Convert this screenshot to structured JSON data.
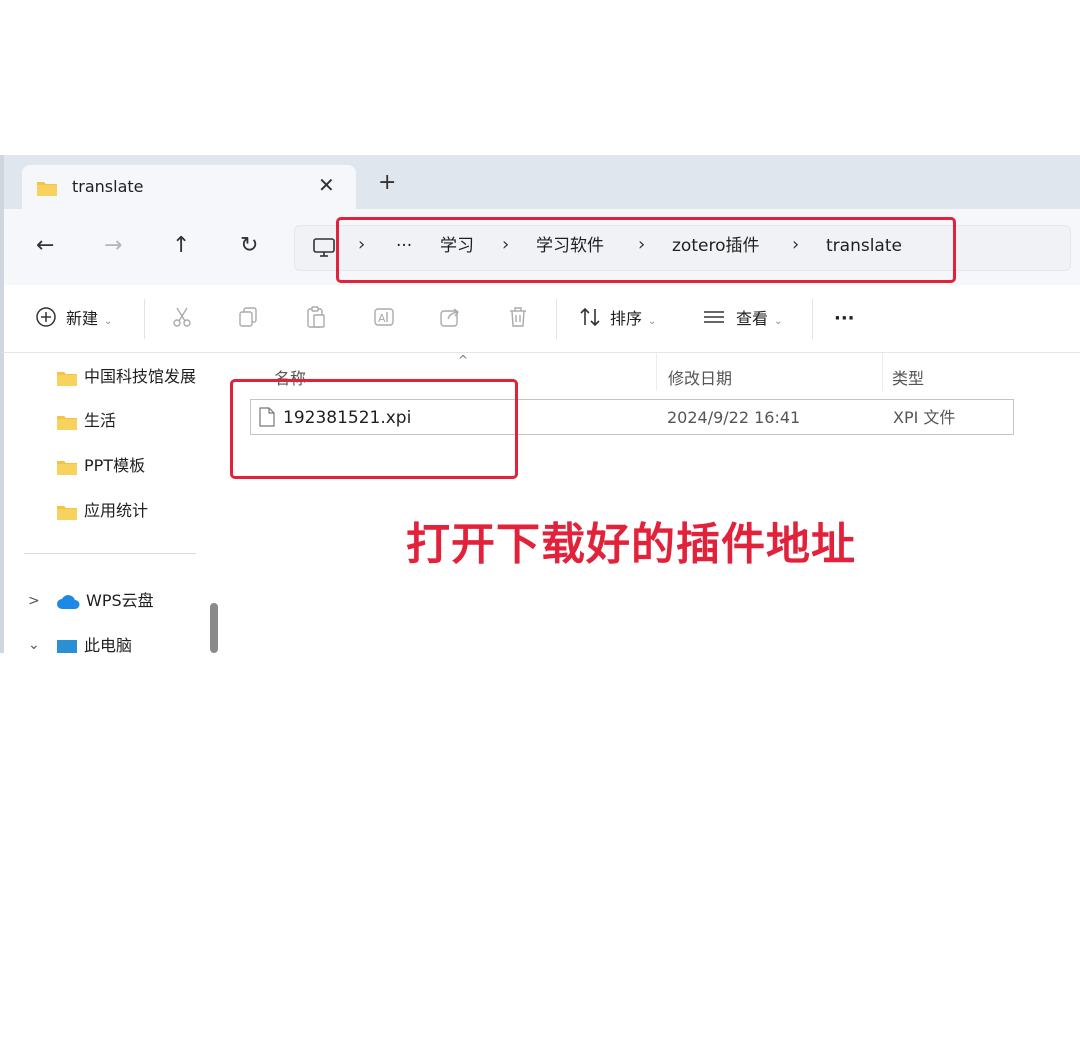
{
  "window": {
    "tab_title": "translate",
    "close_glyph": "✕",
    "new_tab_glyph": "+"
  },
  "nav": {
    "back": "←",
    "forward": "→",
    "up": "↑",
    "refresh": "↻"
  },
  "breadcrumb": {
    "separator": "›",
    "ellipsis": "···",
    "items": [
      "学习",
      "学习软件",
      "zotero插件",
      "translate"
    ]
  },
  "toolbar": {
    "new_label": "新建",
    "sort_label": "排序",
    "view_label": "查看",
    "more_glyph": "···",
    "icons": [
      "cut-icon",
      "copy-icon",
      "paste-icon",
      "rename-icon",
      "share-icon",
      "delete-icon"
    ]
  },
  "sidebar": {
    "folders": [
      "中国科技馆发展",
      "生活",
      "PPT模板",
      "应用统计"
    ],
    "locations": [
      {
        "label": "WPS云盘",
        "expander": ">"
      },
      {
        "label": "此电脑",
        "expander": "⌄"
      }
    ]
  },
  "columns": {
    "name": "名称",
    "modified": "修改日期",
    "type": "类型"
  },
  "files": [
    {
      "name": "192381521.xpi",
      "modified": "2024/9/22 16:41",
      "type": "XPI 文件"
    }
  ],
  "annotation": "打开下载好的插件地址",
  "colors": {
    "highlight": "#e2223a",
    "folder": "#f5c242",
    "cloud": "#1e88e5"
  }
}
